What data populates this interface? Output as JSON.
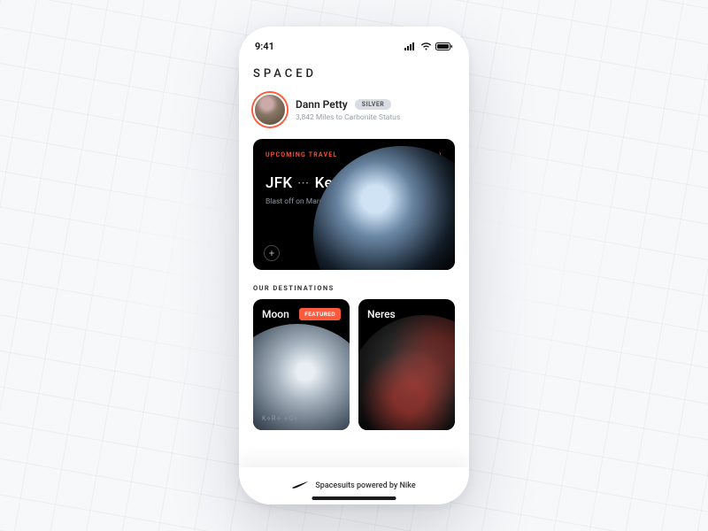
{
  "status": {
    "time": "9:41"
  },
  "brand": "SPACED",
  "profile": {
    "name": "Dann Petty",
    "tier_badge": "SILVER",
    "substatus": "3,842 Miles to Carbonite Status"
  },
  "upcoming": {
    "section_label": "UPCOMING TRAVEL",
    "from": "JFK",
    "to": "Kepler 452B",
    "detail": "Blast off on March 27 at 4:50 PM",
    "decorative_glyphs": "⟨⟡⟢⟩",
    "add_label": "+"
  },
  "destinations": {
    "section_title": "OUR DESTINATIONS",
    "items": [
      {
        "name": "Moon",
        "featured_label": "FEATURED",
        "glyphs": "K⟡R⟡ ⟡O⟡"
      },
      {
        "name": "Neres"
      }
    ]
  },
  "footer": {
    "text": "Spacesuits powered by Nike"
  }
}
